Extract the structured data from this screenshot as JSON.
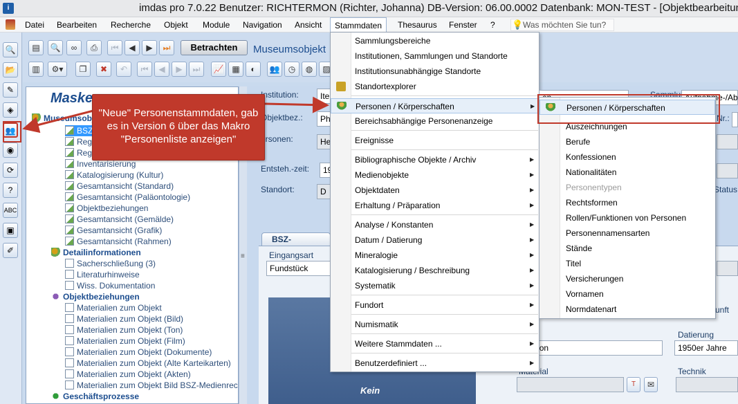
{
  "window": {
    "title": "imdas pro 7.0.22 Benutzer: RICHTERMON (Richter, Johanna)   DB-Version: 06.00.0002   Datenbank: MON-TEST - [Objektbearbeitung - (1"
  },
  "menubar": {
    "items": [
      "Datei",
      "Bearbeiten",
      "Recherche",
      "Objekt",
      "Module",
      "Navigation",
      "Ansicht",
      "Stammdaten",
      "Thesaurus",
      "Fenster",
      "?"
    ],
    "active": "Stammdaten",
    "help_placeholder": "Was möchten Sie tun?"
  },
  "toolbar": {
    "betrachten_label": "Betrachten",
    "title": "Museumsobjekt"
  },
  "tree": {
    "title": "Masken",
    "root_label": "Museumsobjekt",
    "items": [
      "BSZ",
      "Reg",
      "Reg",
      "Inventarisierung",
      "Katalogisierung (Kultur)",
      "Gesamtansicht (Standard)",
      "Gesamtansicht (Paläontologie)",
      "Objektbeziehungen",
      "Gesamtansicht (Gemälde)",
      "Gesamtansicht (Grafik)",
      "Gesamtansicht (Rahmen)"
    ],
    "section_detail": "Detailinformationen",
    "detail_items": [
      "Sacherschließung (3)",
      "Literaturhinweise",
      "Wiss. Dokumentation"
    ],
    "section_beziehungen": "Objektbeziehungen",
    "beziehung_items": [
      "Materialien zum Objekt",
      "Materialien zum Objekt (Bild)",
      "Materialien zum Objekt (Ton)",
      "Materialien zum Objekt (Film)",
      "Materialien zum Objekt (Dokumente)",
      "Materialien zum Objekt (Alte Karteikarten)",
      "Materialien zum Objekt (Akten)",
      "Materialien zum Objekt Bild BSZ-Medienrech"
    ],
    "section_geschaeft": "Geschäftsprozesse"
  },
  "form": {
    "institution_label": "Institution:",
    "institution_value": "Ite",
    "objektbez_label": "Objektbez.:",
    "objektbez_value": "Ph",
    "personen_label": "ersonen:",
    "personen_value": "He",
    "entsteh_label": "Entsteh.-zeit:",
    "entsteh_value": "19",
    "standort_label": "Standort:",
    "standort_value": "D",
    "sammlung_label": "Sammlung:",
    "sammlung_value": "Aufnahme-/Ab",
    "nr_label": "Nr.:",
    "status_label": "Status",
    "kunft_label": "unft",
    "tab_label": "BSZ-Gesamtan",
    "eingangsart_label": "Eingangsart",
    "eingangsart_value": "Fundstück",
    "datierung_label": "Datierung",
    "datierung_value": "1950er Jahre",
    "material_label": "Material",
    "technik_label": "Technik",
    "hersteller_value": "nophon",
    "kein_bild": "Kein"
  },
  "stammdaten_menu": {
    "items": [
      "Sammlungsbereiche",
      "Institutionen, Sammlungen und Standorte",
      "Institutionsunabhängige Standorte",
      "Standortexplorer",
      "Personen / Körperschaften",
      "Bereichsabhängige Personenanzeige",
      "Ereignisse",
      "Bibliographische Objekte / Archiv",
      "Medienobjekte",
      "Objektdaten",
      "Erhaltung / Präparation",
      "Analyse / Konstanten",
      "Datum / Datierung",
      "Mineralogie",
      "Katalogisierung / Beschreibung",
      "Systematik",
      "Fundort",
      "Numismatik",
      "Weitere Stammdaten ...",
      "Benutzerdefiniert ..."
    ],
    "highlighted": "Personen / Körperschaften"
  },
  "personen_submenu": {
    "items": [
      "Personen / Körperschaften",
      "Auszeichnungen",
      "Berufe",
      "Konfessionen",
      "Nationalitäten",
      "Personentypen",
      "Rechtsformen",
      "Rollen/Funktionen von Personen",
      "Personennamensarten",
      "Stände",
      "Titel",
      "Versicherungen",
      "Vornamen",
      "Normdatenart"
    ],
    "disabled": "Personentypen",
    "partial_top": "en"
  },
  "callout": {
    "text": "\"Neue\" Personenstammdaten, gab es in Version 6 über das Makro \"Personenliste anzeigen\""
  },
  "colors": {
    "accent": "#c0392b",
    "highlight": "#3399ff"
  }
}
